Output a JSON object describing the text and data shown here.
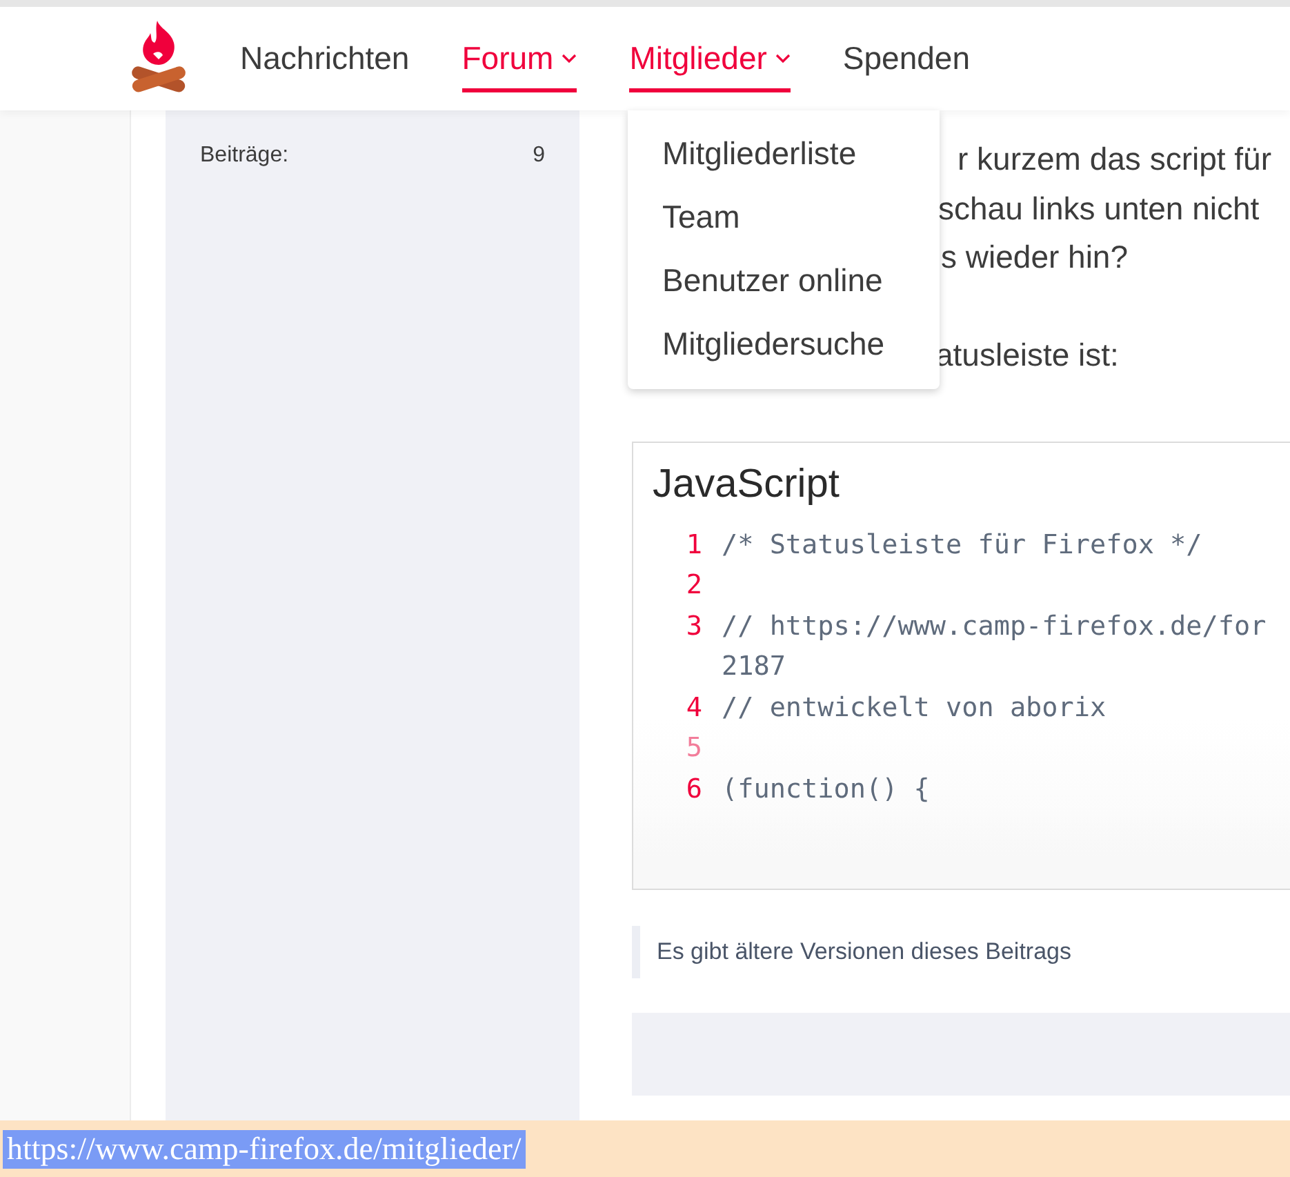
{
  "nav": {
    "items": [
      {
        "label": "Nachrichten",
        "active": false,
        "has_menu": false
      },
      {
        "label": "Forum",
        "active": true,
        "has_menu": true
      },
      {
        "label": "Mitglieder",
        "active": true,
        "has_menu": true
      },
      {
        "label": "Spenden",
        "active": false,
        "has_menu": false
      }
    ],
    "dropdown": {
      "items": [
        "Mitgliederliste",
        "Team",
        "Benutzer online",
        "Mitgliedersuche"
      ]
    }
  },
  "sidebar": {
    "stats": [
      {
        "label": "Beiträge:",
        "value": "9"
      }
    ]
  },
  "post": {
    "paragraphs": [
      [
        "r kurzem das script für",
        "schau links unten nicht",
        "s wieder hin?"
      ],
      [
        "atusleiste ist:"
      ]
    ],
    "code": {
      "language": "JavaScript",
      "lines": [
        {
          "number": "1",
          "text": "/* Statusleiste für Firefox */"
        },
        {
          "number": "2"
        },
        {
          "number": "3",
          "text": "// https://www.camp-firefox.de/for",
          "continuation": "2187"
        },
        {
          "number": "4",
          "text": "// entwickelt von aborix"
        },
        {
          "number": "5"
        },
        {
          "number": "6",
          "text": "(function() {"
        }
      ]
    },
    "versions_note": "Es gibt ältere Versionen dieses Beitrags"
  },
  "status_bar": {
    "url": "https://www.camp-firefox.de/mitglieder/"
  }
}
